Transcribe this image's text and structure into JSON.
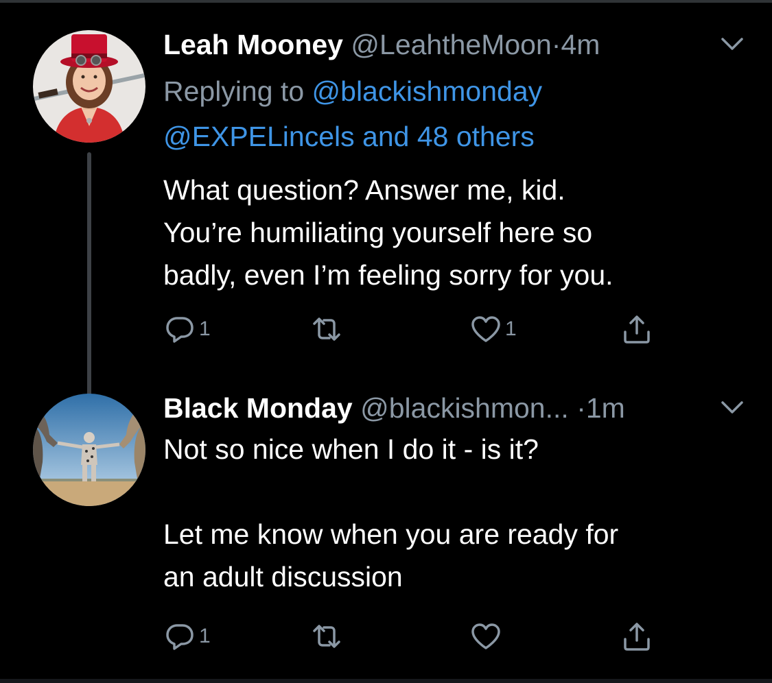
{
  "thread": [
    {
      "author_name": "Leah Mooney",
      "author_handle": "@LeahtheMoon",
      "separator": "·",
      "time": "4m",
      "replying_prefix": "Replying to ",
      "replying_mention": "@blackishmonday",
      "replying_line2": "@EXPELincels and 48 others",
      "body_lines": [
        "What question? Answer me, kid.",
        "You’re humiliating yourself here so",
        "badly, even I’m feeling sorry for you."
      ],
      "reply_count": "1",
      "retweet_count": "",
      "like_count": "1",
      "avatar_icon": "user-avatar-red-top-hat",
      "colors": {
        "avatar_bg": "#e9e6e3",
        "hat": "#c8102e",
        "shirt": "#d32f2f"
      }
    },
    {
      "author_name": "Black Monday",
      "author_handle": "@blackishmon...",
      "separator": "·",
      "time": "1m",
      "body_lines": [
        "Not so nice when I do it - is it?",
        "",
        "Let me know when you are ready for",
        "an adult discussion"
      ],
      "reply_count": "1",
      "retweet_count": "",
      "like_count": "",
      "avatar_icon": "user-avatar-sculpture",
      "colors": {
        "avatar_sky": "#8fb8d8",
        "avatar_ground": "#c9a97a"
      }
    }
  ],
  "theme": {
    "background": "#000000",
    "text": "#ffffff",
    "secondary_text": "#8b98a5",
    "link": "#3f95e6",
    "thread_line": "#3d4146"
  },
  "icons": {
    "reply": "reply-icon",
    "retweet": "retweet-icon",
    "like": "heart-icon",
    "share": "share-icon",
    "menu": "chevron-down-icon"
  }
}
